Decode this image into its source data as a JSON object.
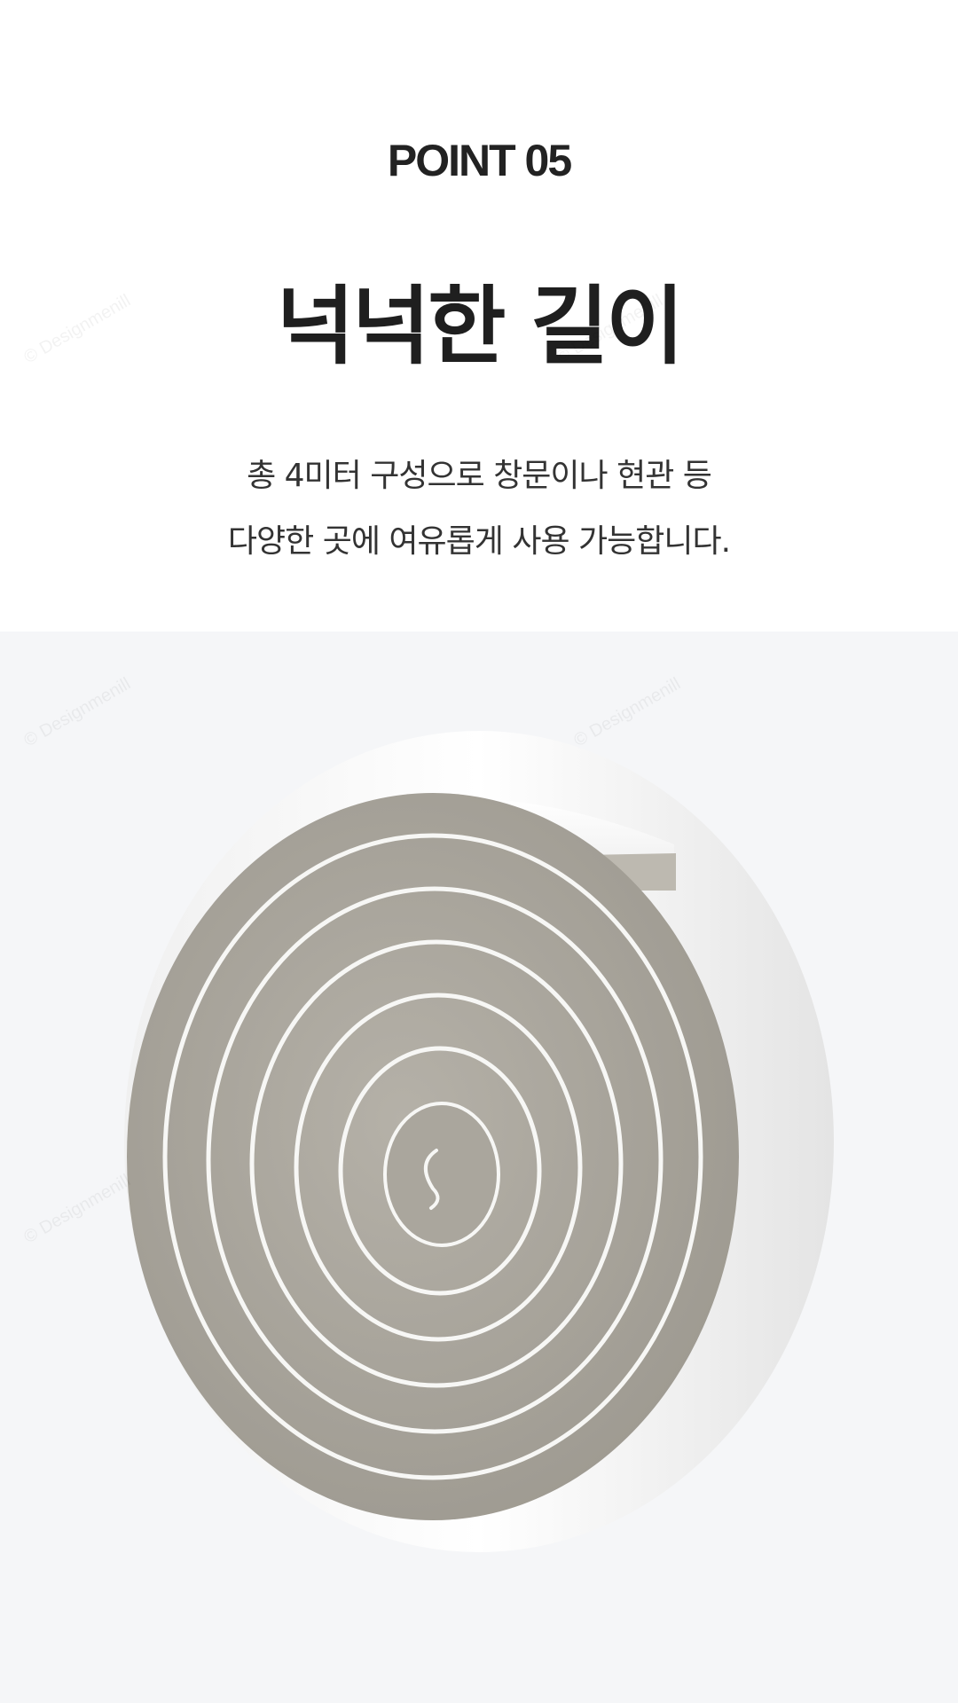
{
  "point_label": "POINT 05",
  "headline": "넉넉한 길이",
  "description": {
    "line1": "총 4미터 구성으로 창문이나 현관 등",
    "line2": "다양한 곳에 여유롭게 사용 가능합니다."
  },
  "product_image": {
    "subject": "weatherstrip-foam-roll",
    "foam_color": "#a8a49b",
    "backing_color": "#ffffff",
    "background_color": "#f5f6f8"
  },
  "watermark": "© Designmenill"
}
